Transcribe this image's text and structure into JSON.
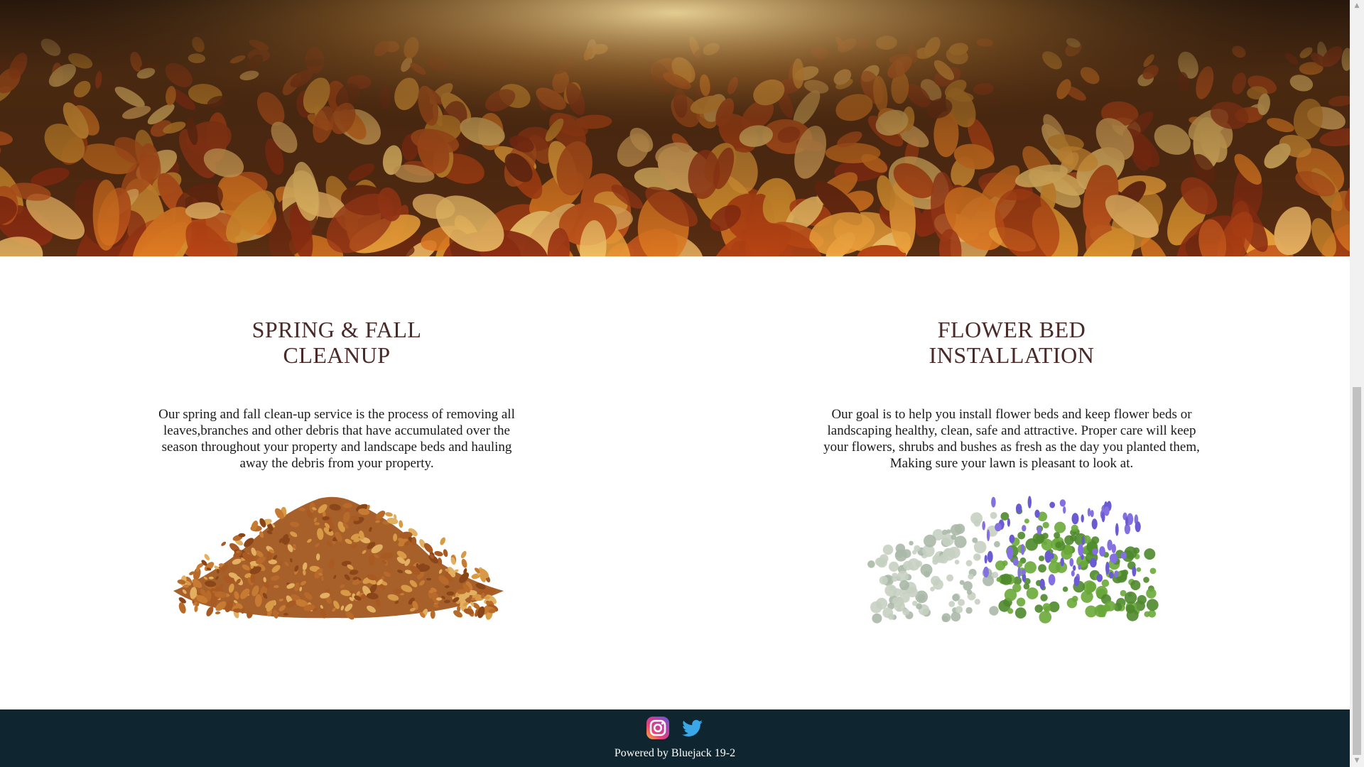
{
  "hero": {
    "image": "autumn-leaves-forest-floor"
  },
  "services": [
    {
      "title_line1": "SPRING & FALL",
      "title_line2": "CLEANUP",
      "description": "Our spring and fall clean-up service is the process of removing all leaves,branches and other debris that have accumulated over the season throughout your property and landscape beds and hauling away the debris from your property.",
      "image": "leaf-pile"
    },
    {
      "title_line1": "FLOWER BED",
      "title_line2": "INSTALLATION",
      "description": "Our goal is to help you install flower beds and keep flower beds or landscaping healthy, clean, safe and attractive. Proper care will keep your flowers, shrubs and bushes as fresh as the day you planted them, Making sure your lawn is pleasant to look at.",
      "image": "flowering-shrub"
    }
  ],
  "footer": {
    "socials": [
      {
        "name": "instagram",
        "icon": "instagram-icon"
      },
      {
        "name": "twitter",
        "icon": "twitter-icon"
      }
    ],
    "powered_by": "Powered by Bluejack 19-2",
    "background": "#0f2530"
  },
  "colors": {
    "heading": "#4a2a28",
    "body_text": "#1a1a1a",
    "footer_bg": "#0f2530"
  }
}
